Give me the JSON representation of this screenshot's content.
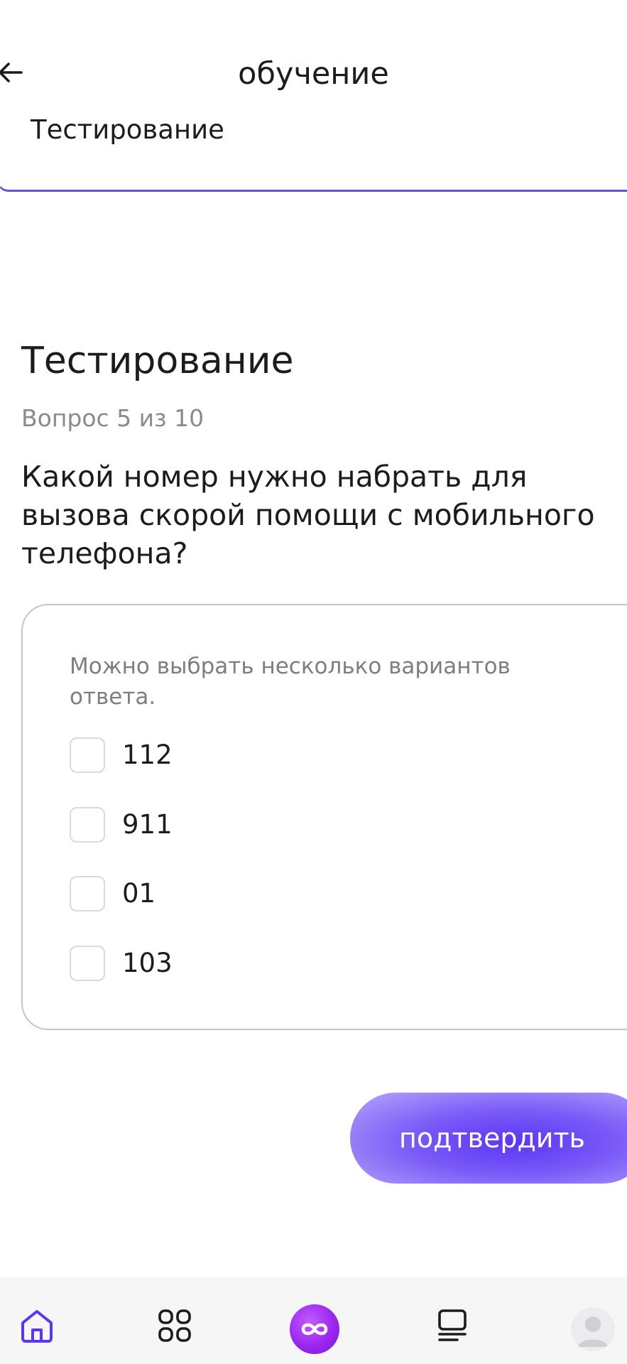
{
  "header": {
    "title": "обучение"
  },
  "section": {
    "label": "Тестирование"
  },
  "test": {
    "title": "Тестирование",
    "progress": "Вопрос 5 из 10",
    "question": "Какой номер нужно набрать для вызова скорой помощи с мобильного телефона?",
    "hint": "Можно выбрать несколько вариантов ответа.",
    "options": [
      {
        "label": "112",
        "checked": false
      },
      {
        "label": "911",
        "checked": false
      },
      {
        "label": "01",
        "checked": false
      },
      {
        "label": "103",
        "checked": false
      }
    ],
    "confirm_label": "подтвердить"
  },
  "nav": {
    "items": [
      "home-icon",
      "grid-icon",
      "center-infinity-icon",
      "list-icon",
      "profile-avatar"
    ]
  },
  "colors": {
    "accent": "#6a4fd8",
    "button": "#5b35f5",
    "nav_center": "#9c27f0"
  }
}
